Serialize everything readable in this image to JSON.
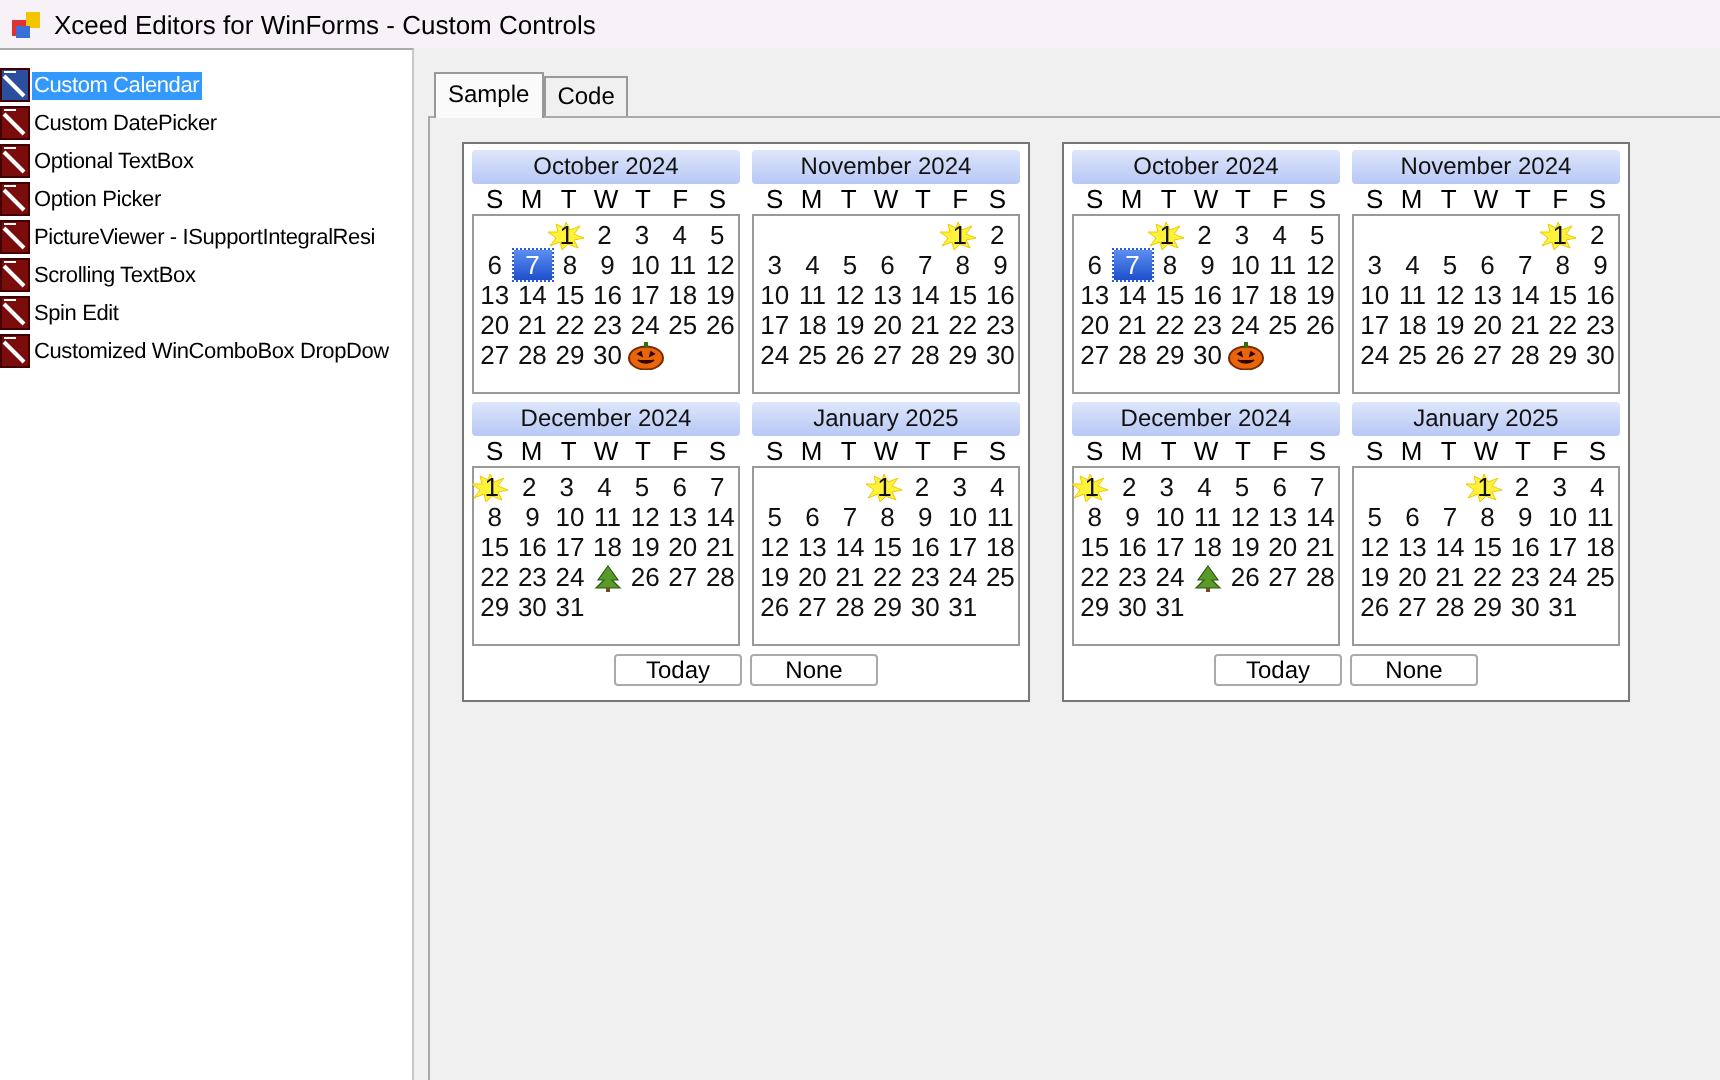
{
  "window": {
    "title": "Xceed Editors for WinForms - Custom Controls"
  },
  "sidebar": {
    "items": [
      {
        "label": "Custom Calendar",
        "selected": true
      },
      {
        "label": "Custom DatePicker",
        "selected": false
      },
      {
        "label": "Optional TextBox",
        "selected": false
      },
      {
        "label": "Option Picker",
        "selected": false
      },
      {
        "label": "PictureViewer - ISupportIntegralResi",
        "selected": false
      },
      {
        "label": "Scrolling TextBox",
        "selected": false
      },
      {
        "label": "Spin Edit",
        "selected": false
      },
      {
        "label": "Customized WinComboBox DropDow",
        "selected": false
      }
    ]
  },
  "tabs": [
    {
      "label": "Sample",
      "selected": true
    },
    {
      "label": "Code",
      "selected": false
    }
  ],
  "calendars": [
    {
      "months": [
        {
          "title": "October 2024",
          "weekdays": [
            "S",
            "M",
            "T",
            "W",
            "T",
            "F",
            "S"
          ],
          "weeks": [
            {
              "kind": "first",
              "days": [
                {
                  "day": "1",
                  "kind": "sun",
                  "selected": false
                },
                "2",
                "3",
                "4",
                "5"
              ]
            },
            {
              "kind": "full",
              "days": [
                "6",
                {
                  "day": "7",
                  "kind": "plain",
                  "selected": true
                },
                "8",
                "9",
                "10",
                "11",
                "12"
              ]
            },
            {
              "kind": "full",
              "days": [
                "13",
                "14",
                "15",
                "16",
                "17",
                "18",
                "19"
              ]
            },
            {
              "kind": "full",
              "days": [
                "20",
                "21",
                "22",
                "23",
                "24",
                "25",
                "26"
              ]
            },
            {
              "kind": "last",
              "days": [
                "27",
                "28",
                "29",
                "30",
                {
                  "kind": "pumpkin",
                  "selected": false
                }
              ]
            }
          ]
        },
        {
          "title": "November 2024",
          "weekdays": [
            "S",
            "M",
            "T",
            "W",
            "T",
            "F",
            "S"
          ],
          "weeks": [
            {
              "kind": "first",
              "days": [
                {
                  "day": "1",
                  "kind": "sun",
                  "selected": false
                },
                "2"
              ]
            },
            {
              "kind": "full",
              "days": [
                "3",
                "4",
                "5",
                "6",
                "7",
                "8",
                "9"
              ]
            },
            {
              "kind": "full",
              "days": [
                "10",
                "11",
                "12",
                "13",
                "14",
                "15",
                "16"
              ]
            },
            {
              "kind": "full",
              "days": [
                "17",
                "18",
                "19",
                "20",
                "21",
                "22",
                "23"
              ]
            },
            {
              "kind": "last",
              "days": [
                "24",
                "25",
                "26",
                "27",
                "28",
                "29",
                "30"
              ]
            }
          ]
        },
        {
          "title": "December 2024",
          "weekdays": [
            "S",
            "M",
            "T",
            "W",
            "T",
            "F",
            "S"
          ],
          "weeks": [
            {
              "kind": "first",
              "days": [
                {
                  "day": "1",
                  "kind": "sun",
                  "selected": false
                },
                "2",
                "3",
                "4",
                "5",
                "6",
                "7"
              ]
            },
            {
              "kind": "full",
              "days": [
                "8",
                "9",
                "10",
                "11",
                "12",
                "13",
                "14"
              ]
            },
            {
              "kind": "full",
              "days": [
                "15",
                "16",
                "17",
                "18",
                "19",
                "20",
                "21"
              ]
            },
            {
              "kind": "full",
              "days": [
                "22",
                "23",
                "24",
                {
                  "kind": "tree",
                  "selected": false
                },
                "26",
                "27",
                "28"
              ]
            },
            {
              "kind": "last",
              "days": [
                "29",
                "30",
                "31"
              ]
            }
          ]
        },
        {
          "title": "January 2025",
          "weekdays": [
            "S",
            "M",
            "T",
            "W",
            "T",
            "F",
            "S"
          ],
          "weeks": [
            {
              "kind": "first",
              "days": [
                {
                  "day": "1",
                  "kind": "sun",
                  "selected": false
                },
                "2",
                "3",
                "4"
              ]
            },
            {
              "kind": "full",
              "days": [
                "5",
                "6",
                "7",
                "8",
                "9",
                "10",
                "11"
              ]
            },
            {
              "kind": "full",
              "days": [
                "12",
                "13",
                "14",
                "15",
                "16",
                "17",
                "18"
              ]
            },
            {
              "kind": "full",
              "days": [
                "19",
                "20",
                "21",
                "22",
                "23",
                "24",
                "25"
              ]
            },
            {
              "kind": "last",
              "days": [
                "26",
                "27",
                "28",
                "29",
                "30",
                "31"
              ]
            }
          ]
        }
      ],
      "buttons": [
        "Today",
        "None"
      ]
    },
    {
      "months": [
        {
          "title": "October 2024",
          "weekdays": [
            "S",
            "M",
            "T",
            "W",
            "T",
            "F",
            "S"
          ],
          "weeks": [
            {
              "kind": "first",
              "days": [
                {
                  "day": "1",
                  "kind": "sun",
                  "selected": false
                },
                "2",
                "3",
                "4",
                "5"
              ]
            },
            {
              "kind": "full",
              "days": [
                "6",
                {
                  "day": "7",
                  "kind": "plain",
                  "selected": true
                },
                "8",
                "9",
                "10",
                "11",
                "12"
              ]
            },
            {
              "kind": "full",
              "days": [
                "13",
                "14",
                "15",
                "16",
                "17",
                "18",
                "19"
              ]
            },
            {
              "kind": "full",
              "days": [
                "20",
                "21",
                "22",
                "23",
                "24",
                "25",
                "26"
              ]
            },
            {
              "kind": "last",
              "days": [
                "27",
                "28",
                "29",
                "30",
                {
                  "kind": "pumpkin",
                  "selected": false
                }
              ]
            }
          ]
        },
        {
          "title": "November 2024",
          "weekdays": [
            "S",
            "M",
            "T",
            "W",
            "T",
            "F",
            "S"
          ],
          "weeks": [
            {
              "kind": "first",
              "days": [
                {
                  "day": "1",
                  "kind": "sun",
                  "selected": false
                },
                "2"
              ]
            },
            {
              "kind": "full",
              "days": [
                "3",
                "4",
                "5",
                "6",
                "7",
                "8",
                "9"
              ]
            },
            {
              "kind": "full",
              "days": [
                "10",
                "11",
                "12",
                "13",
                "14",
                "15",
                "16"
              ]
            },
            {
              "kind": "full",
              "days": [
                "17",
                "18",
                "19",
                "20",
                "21",
                "22",
                "23"
              ]
            },
            {
              "kind": "last",
              "days": [
                "24",
                "25",
                "26",
                "27",
                "28",
                "29",
                "30"
              ]
            }
          ]
        },
        {
          "title": "December 2024",
          "weekdays": [
            "S",
            "M",
            "T",
            "W",
            "T",
            "F",
            "S"
          ],
          "weeks": [
            {
              "kind": "first",
              "days": [
                {
                  "day": "1",
                  "kind": "sun",
                  "selected": false
                },
                "2",
                "3",
                "4",
                "5",
                "6",
                "7"
              ]
            },
            {
              "kind": "full",
              "days": [
                "8",
                "9",
                "10",
                "11",
                "12",
                "13",
                "14"
              ]
            },
            {
              "kind": "full",
              "days": [
                "15",
                "16",
                "17",
                "18",
                "19",
                "20",
                "21"
              ]
            },
            {
              "kind": "full",
              "days": [
                "22",
                "23",
                "24",
                {
                  "kind": "tree",
                  "selected": false
                },
                "26",
                "27",
                "28"
              ]
            },
            {
              "kind": "last",
              "days": [
                "29",
                "30",
                "31"
              ]
            }
          ]
        },
        {
          "title": "January 2025",
          "weekdays": [
            "S",
            "M",
            "T",
            "W",
            "T",
            "F",
            "S"
          ],
          "weeks": [
            {
              "kind": "first",
              "days": [
                {
                  "day": "1",
                  "kind": "sun",
                  "selected": false
                },
                "2",
                "3",
                "4"
              ]
            },
            {
              "kind": "full",
              "days": [
                "5",
                "6",
                "7",
                "8",
                "9",
                "10",
                "11"
              ]
            },
            {
              "kind": "full",
              "days": [
                "12",
                "13",
                "14",
                "15",
                "16",
                "17",
                "18"
              ]
            },
            {
              "kind": "full",
              "days": [
                "19",
                "20",
                "21",
                "22",
                "23",
                "24",
                "25"
              ]
            },
            {
              "kind": "last",
              "days": [
                "26",
                "27",
                "28",
                "29",
                "30",
                "31"
              ]
            }
          ]
        }
      ],
      "buttons": [
        "Today",
        "None"
      ]
    }
  ]
}
